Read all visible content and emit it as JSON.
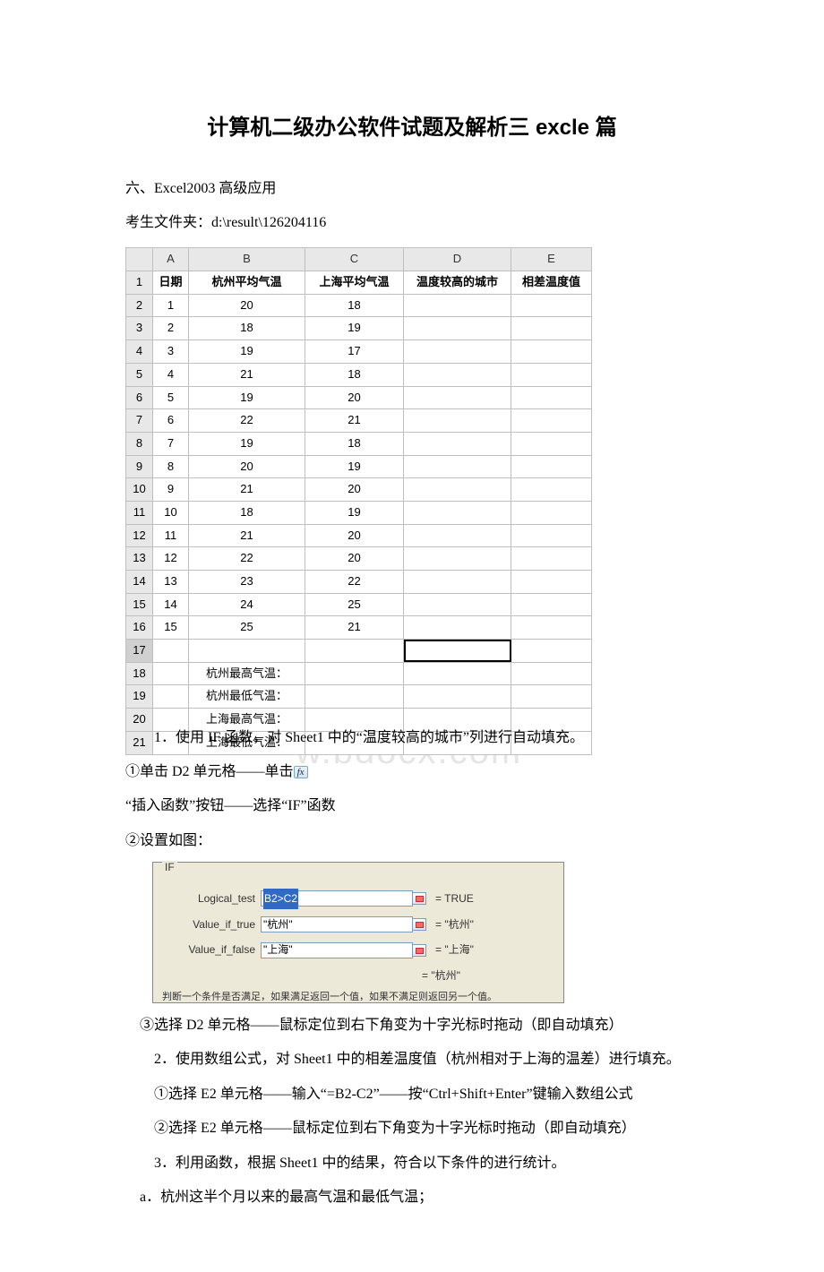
{
  "title": "计算机二级办公软件试题及解析三 excle 篇",
  "section": "六、Excel2003 高级应用",
  "folder_line": "考生文件夹：d:\\result\\126204116",
  "columns": [
    "A",
    "B",
    "C",
    "D",
    "E"
  ],
  "headers": {
    "A": "日期",
    "B": "杭州平均气温",
    "C": "上海平均气温",
    "D": "温度较高的城市",
    "E": "相差温度值"
  },
  "rows": [
    {
      "n": 1,
      "A": "1",
      "B": "20",
      "C": "18"
    },
    {
      "n": 2,
      "A": "2",
      "B": "18",
      "C": "19"
    },
    {
      "n": 3,
      "A": "3",
      "B": "19",
      "C": "17"
    },
    {
      "n": 4,
      "A": "4",
      "B": "21",
      "C": "18"
    },
    {
      "n": 5,
      "A": "5",
      "B": "19",
      "C": "20"
    },
    {
      "n": 6,
      "A": "6",
      "B": "22",
      "C": "21"
    },
    {
      "n": 7,
      "A": "7",
      "B": "19",
      "C": "18"
    },
    {
      "n": 8,
      "A": "8",
      "B": "20",
      "C": "19"
    },
    {
      "n": 9,
      "A": "9",
      "B": "21",
      "C": "20"
    },
    {
      "n": 10,
      "A": "10",
      "B": "18",
      "C": "19"
    },
    {
      "n": 11,
      "A": "11",
      "B": "21",
      "C": "20"
    },
    {
      "n": 12,
      "A": "12",
      "B": "22",
      "C": "20"
    },
    {
      "n": 13,
      "A": "13",
      "B": "23",
      "C": "22"
    },
    {
      "n": 14,
      "A": "14",
      "B": "24",
      "C": "25"
    },
    {
      "n": 15,
      "A": "15",
      "B": "25",
      "C": "21"
    }
  ],
  "label_rows": [
    {
      "n": 18,
      "B": "杭州最高气温："
    },
    {
      "n": 19,
      "B": "杭州最低气温："
    },
    {
      "n": 20,
      "B": "上海最高气温："
    },
    {
      "n": 21,
      "B": "上海最低气温："
    }
  ],
  "q1": "1．使用 IF 函数，对 Sheet1 中的“温度较高的城市”列进行自动填充。",
  "q1_step1_pre": "①单击 D2 单元格——单击",
  "q1_step1_post": "“插入函数”按钮——选择“IF”函数",
  "q1_step2": "②设置如图：",
  "dialog": {
    "group": "IF",
    "logical_label": "Logical_test",
    "logical_value": "B2>C2",
    "logical_eval": "= TRUE",
    "true_label": "Value_if_true",
    "true_value": "\"杭州\"",
    "true_eval": "= \"杭州\"",
    "false_label": "Value_if_false",
    "false_value": "\"上海\"",
    "false_eval": "= \"上海\"",
    "result": "= \"杭州\"",
    "clipped": "判断一个条件是否满足，如果满足返回一个值，如果不满足则返回另一个值。"
  },
  "q1_step3": "　③选择 D2 单元格——鼠标定位到右下角变为十字光标时拖动（即自动填充）",
  "q2": "2．使用数组公式，对 Sheet1 中的相差温度值（杭州相对于上海的温差）进行填充。",
  "q2_step1": "①选择 E2 单元格——输入“=B2-C2”——按“Ctrl+Shift+Enter”键输入数组公式",
  "q2_step2": "②选择 E2 单元格——鼠标定位到右下角变为十字光标时拖动（即自动填充）",
  "q3": "3．利用函数，根据 Sheet1 中的结果，符合以下条件的进行统计。",
  "q3_a": "　a．杭州这半个月以来的最高气温和最低气温；",
  "fx_glyph": "fx",
  "watermark": "w.bdocx.com"
}
